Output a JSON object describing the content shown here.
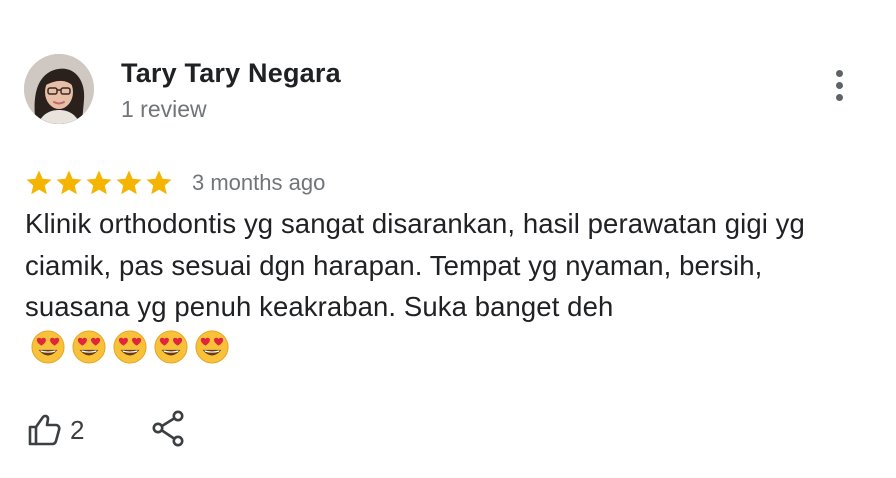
{
  "review": {
    "author": {
      "name": "Tary Tary Negara",
      "review_count": "1 review",
      "avatar": "profile-photo"
    },
    "rating": {
      "stars": 5,
      "max_stars": 5,
      "star_color": "#f4b400"
    },
    "timestamp": "3 months ago",
    "text": "Klinik orthodontis yg sangat disarankan, hasil perawatan gigi yg ciamik, pas sesuai dgn harapan. Tempat yg nyaman, bersih, suasana yg penuh keakraban. Suka banget deh",
    "emojis": [
      "heart-eyes-emoji",
      "heart-eyes-emoji",
      "heart-eyes-emoji",
      "heart-eyes-emoji",
      "heart-eyes-emoji"
    ],
    "emoji_count": 5
  },
  "actions": {
    "like_icon": "thumbs-up-icon",
    "like_count": "2",
    "share_icon": "share-icon",
    "more_icon": "more-vertical-icon"
  },
  "colors": {
    "text_primary": "#202124",
    "text_secondary": "#70757a",
    "icon": "#3c4043"
  }
}
